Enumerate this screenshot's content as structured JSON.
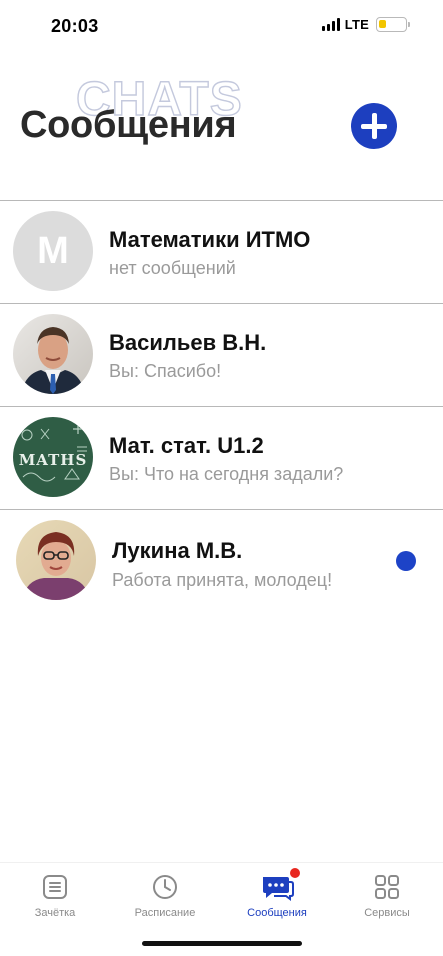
{
  "status_bar": {
    "time": "20:03",
    "network": "LTE",
    "battery_level": 0.2,
    "battery_color": "#f2c500"
  },
  "header": {
    "watermark": "CHATS",
    "title": "Сообщения",
    "add_button_icon": "plus-icon",
    "accent_color": "#1d3fbf"
  },
  "chats": [
    {
      "name": "Математики ИТМО",
      "preview": "нет сообщений",
      "avatar_letter": "M",
      "avatar": "letter-avatar",
      "unread": false
    },
    {
      "name": "Васильев В.Н.",
      "preview": "Вы: Спасибо!",
      "avatar": "man-portrait-photo",
      "unread": false
    },
    {
      "name": "Мат. стат. U1.2",
      "preview": "Вы: Что на сегодня задали?",
      "avatar": "maths-chalkboard-image",
      "unread": false
    },
    {
      "name": "Лукина М.В.",
      "preview": "Работа принята, молодец!",
      "avatar": "woman-portrait-photo",
      "unread": true
    }
  ],
  "tabs": [
    {
      "label": "Зачётка",
      "icon": "gradebook-icon",
      "active": false
    },
    {
      "label": "Расписание",
      "icon": "clock-icon",
      "active": false
    },
    {
      "label": "Сообщения",
      "icon": "chat-bubbles-icon",
      "active": true,
      "badge": true
    },
    {
      "label": "Сервисы",
      "icon": "grid-icon",
      "active": false
    }
  ]
}
